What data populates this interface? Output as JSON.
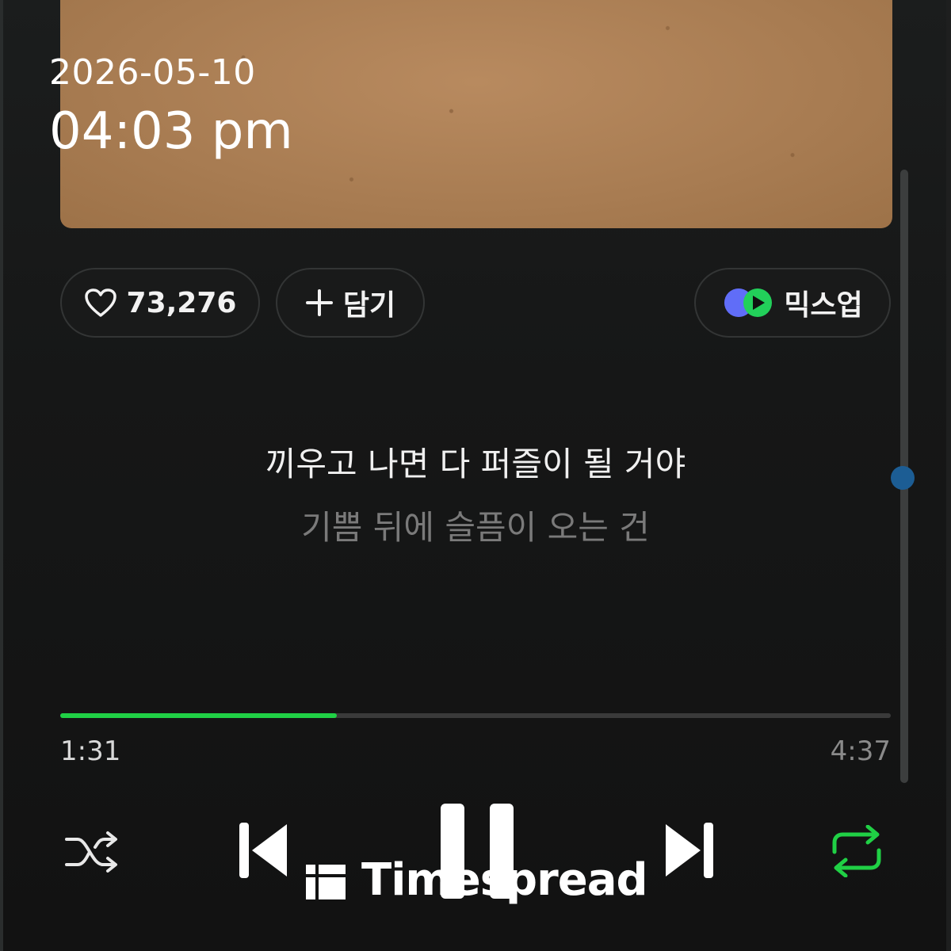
{
  "status": {
    "date": "2026-05-10",
    "time": "04:03 pm"
  },
  "album": {
    "icon": "kraft-paper-album-art"
  },
  "actions": {
    "like_count": "73,276",
    "add_label": "담기",
    "mixup_label": "믹스업"
  },
  "lyrics": {
    "current": "끼우고 나면 다 퍼즐이 될 거야",
    "next": "기쁨 뒤에 슬픔이 오는 건"
  },
  "playback": {
    "elapsed": "1:31",
    "total": "4:37",
    "progress_fraction": 0.333,
    "accent_color": "#20d045",
    "shuffle_icon": "shuffle-icon",
    "prev_icon": "previous-icon",
    "pause_icon": "pause-icon",
    "next_icon": "next-icon",
    "repeat_icon": "repeat-icon",
    "repeat_active": true
  },
  "watermark": {
    "text": "Timespread"
  }
}
